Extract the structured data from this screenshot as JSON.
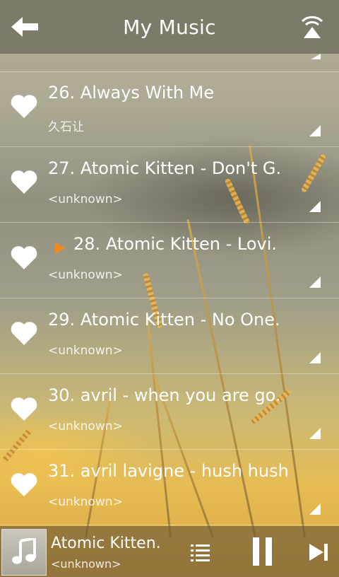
{
  "header": {
    "title": "My Music"
  },
  "songs": [
    {
      "title": "26. Always With Me",
      "artist": "久石让",
      "playing": false
    },
    {
      "title": "27. Atomic Kitten - Don't G.",
      "artist": "<unknown>",
      "playing": false
    },
    {
      "title": "28. Atomic Kitten - Lovi.",
      "artist": "<unknown>",
      "playing": true
    },
    {
      "title": "29. Atomic Kitten - No One.",
      "artist": "<unknown>",
      "playing": false
    },
    {
      "title": "30. avril - when you are go.",
      "artist": "<unknown>",
      "playing": false
    },
    {
      "title": "31. avril lavigne - hush hush",
      "artist": "<unknown>",
      "playing": false
    }
  ],
  "now_playing": {
    "title": "Atomic Kitten.",
    "artist": "<unknown>"
  },
  "colors": {
    "play_marker": "#f08a1c",
    "text": "#ffffff"
  },
  "icons": {
    "back": "back-arrow-icon",
    "broadcast": "broadcast-icon",
    "favorite": "heart-icon",
    "more": "corner-menu-icon",
    "album": "music-note-icon",
    "playlist": "playlist-icon",
    "pause": "pause-icon",
    "next": "next-track-icon"
  }
}
